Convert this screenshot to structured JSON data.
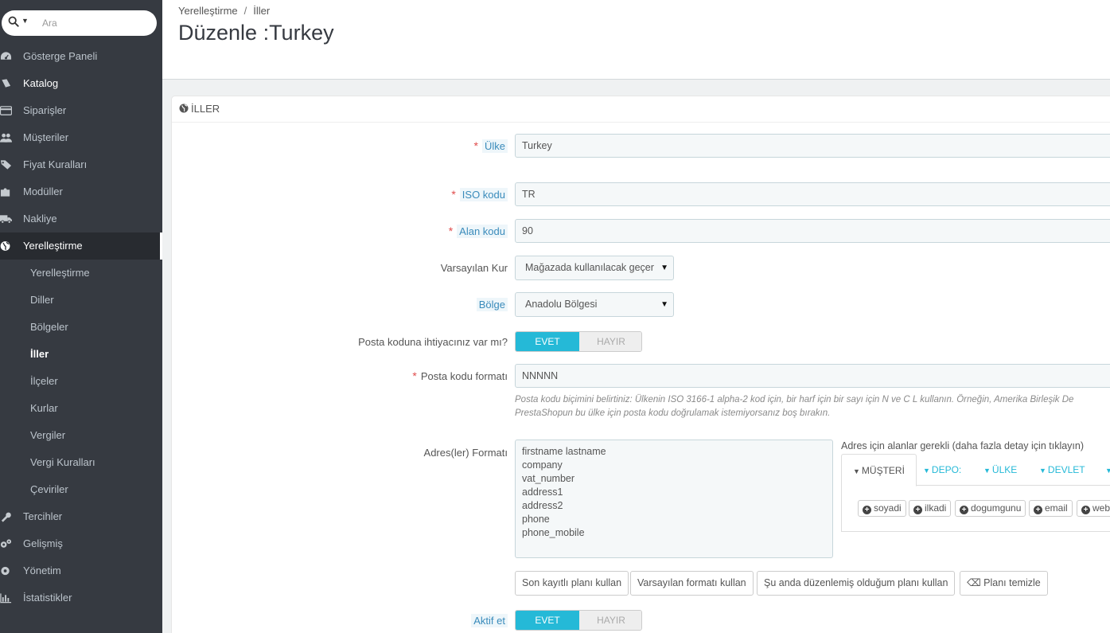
{
  "search": {
    "placeholder": "Ara"
  },
  "sidebar": {
    "items": [
      {
        "label": "Gösterge Paneli",
        "icon": "dashboard-icon"
      },
      {
        "label": "Katalog",
        "icon": "book-icon"
      },
      {
        "label": "Siparişler",
        "icon": "credit-card-icon"
      },
      {
        "label": "Müşteriler",
        "icon": "users-icon"
      },
      {
        "label": "Fiyat Kuralları",
        "icon": "tags-icon"
      },
      {
        "label": "Modüller",
        "icon": "puzzle-icon"
      },
      {
        "label": "Nakliye",
        "icon": "truck-icon"
      },
      {
        "label": "Yerelleştirme",
        "icon": "globe-icon"
      },
      {
        "label": "Tercihler",
        "icon": "wrench-icon"
      },
      {
        "label": "Gelişmiş",
        "icon": "cogs-icon"
      },
      {
        "label": "Yönetim",
        "icon": "cog-icon"
      },
      {
        "label": "İstatistikler",
        "icon": "bar-chart-icon"
      }
    ],
    "submenu": [
      "Yerelleştirme",
      "Diller",
      "Bölgeler",
      "İller",
      "İlçeler",
      "Kurlar",
      "Vergiler",
      "Vergi Kuralları",
      "Çeviriler"
    ]
  },
  "header": {
    "breadcrumb": [
      "Yerelleştirme",
      "İller"
    ],
    "breadcrumb_sep": "/",
    "title": "Düzenle :Turkey"
  },
  "panel": {
    "heading": "İLLER",
    "fields": {
      "country": {
        "label": "Ülke",
        "value": "Turkey"
      },
      "iso": {
        "label": "ISO kodu",
        "value": "TR"
      },
      "call_prefix": {
        "label": "Alan kodu",
        "value": "90"
      },
      "currency": {
        "label": "Varsayılan Kur",
        "value": "Mağazada kullanılacak geçer"
      },
      "zone": {
        "label": "Bölge",
        "value": "Anadolu Bölgesi"
      },
      "need_zip": {
        "label": "Posta koduna ihtiyacınız var mı?",
        "on": "EVET",
        "off": "HAYIR"
      },
      "zip_format": {
        "label": "Posta kodu formatı",
        "value": "NNNNN",
        "help1": "Posta kodu biçimini belirtiniz: Ülkenin ISO 3166-1 alpha-2 kod için, bir harf için bir sayı için N ve C L kullanın. Örneğin, Amerika Birleşik De",
        "help2": "PrestaShopun bu ülke için posta kodu doğrulamak istemiyorsanız boş bırakın."
      },
      "address_format": {
        "label": "Adres(ler) Formatı",
        "lines": [
          "firstname lastname",
          "company",
          "vat_number",
          "address1",
          "address2",
          "phone",
          "phone_mobile"
        ]
      },
      "fields_help": "Adres için alanlar gerekli (daha fazla detay için tıklayın)",
      "tabs": [
        "MÜŞTERİ",
        "DEPO:",
        "ÜLKE",
        "DEVLET"
      ],
      "chips": [
        "soyadi",
        "ilkadi",
        "dogumgunu",
        "email",
        "websi"
      ],
      "buttons": [
        "Son kayıtlı planı kullan",
        "Varsayılan formatı kullan",
        "Şu anda düzenlemiş olduğum planı kullan",
        "Planı temizle"
      ],
      "active": {
        "label": "Aktif et",
        "on": "EVET",
        "off": "HAYIR"
      }
    }
  },
  "colors": {
    "sidebar": "#363a41",
    "accent": "#25b9d7",
    "required": "#e04b4b"
  }
}
